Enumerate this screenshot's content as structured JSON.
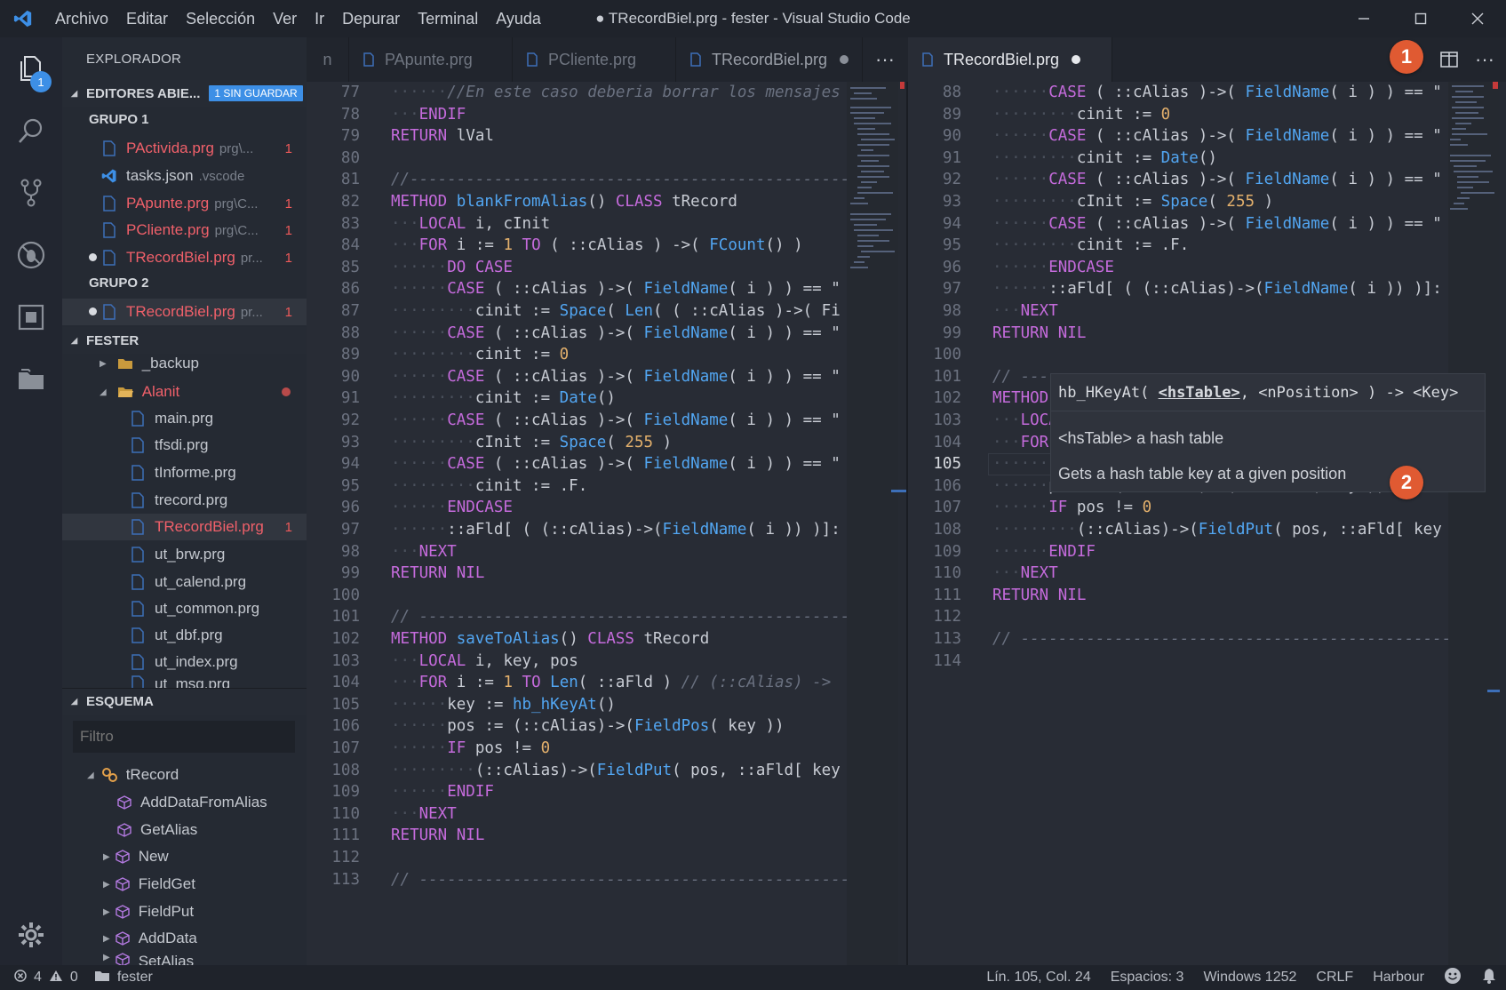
{
  "window": {
    "title": "● TRecordBiel.prg - fester - Visual Studio Code",
    "menu": [
      "Archivo",
      "Editar",
      "Selección",
      "Ver",
      "Ir",
      "Depurar",
      "Terminal",
      "Ayuda"
    ]
  },
  "activity": {
    "explorer_badge": "1"
  },
  "sidebar": {
    "title": "EXPLORADOR",
    "open_editors": {
      "label": "EDITORES ABIE...",
      "badge": "1 SIN GUARDAR",
      "group1": "GRUPO 1",
      "group2": "GRUPO 2",
      "items1": [
        {
          "name": "PActivida.prg",
          "path": "prg\\...",
          "count": "1"
        },
        {
          "name": "tasks.json",
          "path": ".vscode",
          "count": ""
        },
        {
          "name": "PApunte.prg",
          "path": "prg\\C...",
          "count": "1"
        },
        {
          "name": "PCliente.prg",
          "path": "prg\\C...",
          "count": "1"
        },
        {
          "name": "TRecordBiel.prg",
          "path": "pr...",
          "count": "1"
        }
      ],
      "items2": [
        {
          "name": "TRecordBiel.prg",
          "path": "pr...",
          "count": "1"
        }
      ]
    },
    "folder": {
      "label": "FESTER",
      "items": [
        {
          "name": "_backup"
        },
        {
          "name": "Alanit"
        },
        {
          "name": "main.prg"
        },
        {
          "name": "tfsdi.prg"
        },
        {
          "name": "tInforme.prg"
        },
        {
          "name": "trecord.prg"
        },
        {
          "name": "TRecordBiel.prg",
          "count": "1"
        },
        {
          "name": "ut_brw.prg"
        },
        {
          "name": "ut_calend.prg"
        },
        {
          "name": "ut_common.prg"
        },
        {
          "name": "ut_dbf.prg"
        },
        {
          "name": "ut_index.prg"
        },
        {
          "name": "ut_msg.prg"
        }
      ]
    },
    "outline": {
      "label": "ESQUEMA",
      "filter_placeholder": "Filtro",
      "root": "tRecord",
      "items": [
        "AddDataFromAlias",
        "GetAlias",
        "New",
        "FieldGet",
        "FieldPut",
        "AddData",
        "SetAlias"
      ]
    }
  },
  "tabs_left": [
    {
      "label": "n"
    },
    {
      "label": "PApunte.prg"
    },
    {
      "label": "PCliente.prg"
    },
    {
      "label": "TRecordBiel.prg",
      "dirty": true
    }
  ],
  "tabs_right": [
    {
      "label": "TRecordBiel.prg",
      "dirty": true,
      "active": true
    }
  ],
  "more_label": "···",
  "editor_left": {
    "lines": [
      {
        "n": "77",
        "i": 2,
        "t": [
          [
            "cm",
            "//En este caso deberia borrar los mensajes"
          ]
        ]
      },
      {
        "n": "78",
        "i": 1,
        "t": [
          [
            "kw",
            "ENDIF"
          ]
        ]
      },
      {
        "n": "79",
        "i": 0,
        "t": [
          [
            "kw",
            "RETURN"
          ],
          [
            "",
            " lVal"
          ]
        ]
      },
      {
        "n": "80",
        "i": 0,
        "t": []
      },
      {
        "n": "81",
        "i": 0,
        "t": [
          [
            "cm",
            "//-----------------------------------------------"
          ]
        ]
      },
      {
        "n": "82",
        "i": 0,
        "t": [
          [
            "kw",
            "METHOD"
          ],
          [
            "",
            " "
          ],
          [
            "fn",
            "blankFromAlias"
          ],
          [
            "",
            "() "
          ],
          [
            "kw",
            "CLASS"
          ],
          [
            "",
            " tRecord"
          ]
        ]
      },
      {
        "n": "83",
        "i": 1,
        "t": [
          [
            "kw",
            "LOCAL"
          ],
          [
            "",
            " i, cInit"
          ]
        ]
      },
      {
        "n": "84",
        "i": 1,
        "t": [
          [
            "kw",
            "FOR"
          ],
          [
            "",
            " i := "
          ],
          [
            "nm2",
            "1"
          ],
          [
            "",
            " "
          ],
          [
            "kw",
            "TO"
          ],
          [
            "",
            " ( ::cAlias ) ->( "
          ],
          [
            "fn",
            "FCount"
          ],
          [
            "",
            "() )"
          ]
        ]
      },
      {
        "n": "85",
        "i": 2,
        "t": [
          [
            "kw",
            "DO CASE"
          ]
        ]
      },
      {
        "n": "86",
        "i": 2,
        "t": [
          [
            "kw",
            "CASE"
          ],
          [
            "",
            " ( ::cAlias )->( "
          ],
          [
            "fn",
            "FieldName"
          ],
          [
            "",
            "( i ) ) == \""
          ]
        ]
      },
      {
        "n": "87",
        "i": 3,
        "t": [
          [
            "",
            "cinit := "
          ],
          [
            "fn",
            "Space"
          ],
          [
            "",
            "( "
          ],
          [
            "fn",
            "Len"
          ],
          [
            "",
            "( ( ::cAlias )->( Fi"
          ]
        ]
      },
      {
        "n": "88",
        "i": 2,
        "t": [
          [
            "kw",
            "CASE"
          ],
          [
            "",
            " ( ::cAlias )->( "
          ],
          [
            "fn",
            "FieldName"
          ],
          [
            "",
            "( i ) ) == \""
          ]
        ]
      },
      {
        "n": "89",
        "i": 3,
        "t": [
          [
            "",
            "cinit := "
          ],
          [
            "nm2",
            "0"
          ]
        ]
      },
      {
        "n": "90",
        "i": 2,
        "t": [
          [
            "kw",
            "CASE"
          ],
          [
            "",
            " ( ::cAlias )->( "
          ],
          [
            "fn",
            "FieldName"
          ],
          [
            "",
            "( i ) ) == \""
          ]
        ]
      },
      {
        "n": "91",
        "i": 3,
        "t": [
          [
            "",
            "cinit := "
          ],
          [
            "fn",
            "Date"
          ],
          [
            "",
            "()"
          ]
        ]
      },
      {
        "n": "92",
        "i": 2,
        "t": [
          [
            "kw",
            "CASE"
          ],
          [
            "",
            " ( ::cAlias )->( "
          ],
          [
            "fn",
            "FieldName"
          ],
          [
            "",
            "( i ) ) == \""
          ]
        ]
      },
      {
        "n": "93",
        "i": 3,
        "t": [
          [
            "",
            "cInit := "
          ],
          [
            "fn",
            "Space"
          ],
          [
            "",
            "( "
          ],
          [
            "nm2",
            "255"
          ],
          [
            "",
            " )"
          ]
        ]
      },
      {
        "n": "94",
        "i": 2,
        "t": [
          [
            "kw",
            "CASE"
          ],
          [
            "",
            " ( ::cAlias )->( "
          ],
          [
            "fn",
            "FieldName"
          ],
          [
            "",
            "( i ) ) == \""
          ]
        ]
      },
      {
        "n": "95",
        "i": 3,
        "t": [
          [
            "",
            "cinit := .F."
          ]
        ]
      },
      {
        "n": "96",
        "i": 2,
        "t": [
          [
            "kw",
            "ENDCASE"
          ]
        ]
      },
      {
        "n": "97",
        "i": 2,
        "t": [
          [
            "",
            "::aFld[ ( (::cAlias)->("
          ],
          [
            "fn",
            "FieldName"
          ],
          [
            "",
            "( i )) )]:"
          ]
        ]
      },
      {
        "n": "98",
        "i": 1,
        "t": [
          [
            "kw",
            "NEXT"
          ]
        ]
      },
      {
        "n": "99",
        "i": 0,
        "t": [
          [
            "kw",
            "RETURN"
          ],
          [
            "",
            " "
          ],
          [
            "kw",
            "NIL"
          ]
        ]
      },
      {
        "n": "100",
        "i": 0,
        "t": []
      },
      {
        "n": "101",
        "i": 0,
        "t": [
          [
            "cm",
            "// ----------------------------------------------"
          ]
        ]
      },
      {
        "n": "102",
        "i": 0,
        "t": [
          [
            "kw",
            "METHOD"
          ],
          [
            "",
            " "
          ],
          [
            "fn",
            "saveToAlias"
          ],
          [
            "",
            "() "
          ],
          [
            "kw",
            "CLASS"
          ],
          [
            "",
            " tRecord"
          ]
        ]
      },
      {
        "n": "103",
        "i": 1,
        "t": [
          [
            "kw",
            "LOCAL"
          ],
          [
            "",
            " i, key, pos"
          ]
        ]
      },
      {
        "n": "104",
        "i": 1,
        "t": [
          [
            "kw",
            "FOR"
          ],
          [
            "",
            " i := "
          ],
          [
            "nm2",
            "1"
          ],
          [
            "",
            " "
          ],
          [
            "kw",
            "TO"
          ],
          [
            "",
            " "
          ],
          [
            "fn",
            "Len"
          ],
          [
            "",
            "( ::aFld ) "
          ],
          [
            "cm",
            "// (::cAlias) ->"
          ]
        ]
      },
      {
        "n": "105",
        "i": 2,
        "t": [
          [
            "",
            "key := "
          ],
          [
            "fn",
            "hb_hKeyAt"
          ],
          [
            "",
            "()"
          ]
        ]
      },
      {
        "n": "106",
        "i": 2,
        "t": [
          [
            "",
            "pos := (::cAlias)->("
          ],
          [
            "fn",
            "FieldPos"
          ],
          [
            "",
            "( key ))"
          ]
        ]
      },
      {
        "n": "107",
        "i": 2,
        "t": [
          [
            "kw",
            "IF"
          ],
          [
            "",
            " pos != "
          ],
          [
            "nm2",
            "0"
          ]
        ]
      },
      {
        "n": "108",
        "i": 3,
        "t": [
          [
            "",
            "(::cAlias)->("
          ],
          [
            "fn",
            "FieldPut"
          ],
          [
            "",
            "( pos, ::aFld[ key"
          ]
        ]
      },
      {
        "n": "109",
        "i": 2,
        "t": [
          [
            "kw",
            "ENDIF"
          ]
        ]
      },
      {
        "n": "110",
        "i": 1,
        "t": [
          [
            "kw",
            "NEXT"
          ]
        ]
      },
      {
        "n": "111",
        "i": 0,
        "t": [
          [
            "kw",
            "RETURN"
          ],
          [
            "",
            " "
          ],
          [
            "kw",
            "NIL"
          ]
        ]
      },
      {
        "n": "112",
        "i": 0,
        "t": []
      },
      {
        "n": "113",
        "i": 0,
        "t": [
          [
            "cm",
            "// ----------------------------------------------"
          ]
        ]
      }
    ]
  },
  "editor_right": {
    "current_line": "105",
    "lines": [
      {
        "n": "88",
        "i": 2,
        "t": [
          [
            "kw",
            "CASE"
          ],
          [
            "",
            " ( ::cAlias )->( "
          ],
          [
            "fn",
            "FieldName"
          ],
          [
            "",
            "( i ) ) == \""
          ]
        ]
      },
      {
        "n": "89",
        "i": 3,
        "t": [
          [
            "",
            "cinit := "
          ],
          [
            "nm2",
            "0"
          ]
        ]
      },
      {
        "n": "90",
        "i": 2,
        "t": [
          [
            "kw",
            "CASE"
          ],
          [
            "",
            " ( ::cAlias )->( "
          ],
          [
            "fn",
            "FieldName"
          ],
          [
            "",
            "( i ) ) == \""
          ]
        ]
      },
      {
        "n": "91",
        "i": 3,
        "t": [
          [
            "",
            "cinit := "
          ],
          [
            "fn",
            "Date"
          ],
          [
            "",
            "()"
          ]
        ]
      },
      {
        "n": "92",
        "i": 2,
        "t": [
          [
            "kw",
            "CASE"
          ],
          [
            "",
            " ( ::cAlias )->( "
          ],
          [
            "fn",
            "FieldName"
          ],
          [
            "",
            "( i ) ) == \""
          ]
        ]
      },
      {
        "n": "93",
        "i": 3,
        "t": [
          [
            "",
            "cInit := "
          ],
          [
            "fn",
            "Space"
          ],
          [
            "",
            "( "
          ],
          [
            "nm2",
            "255"
          ],
          [
            "",
            " )"
          ]
        ]
      },
      {
        "n": "94",
        "i": 2,
        "t": [
          [
            "kw",
            "CASE"
          ],
          [
            "",
            " ( ::cAlias )->( "
          ],
          [
            "fn",
            "FieldName"
          ],
          [
            "",
            "( i ) ) == \""
          ]
        ]
      },
      {
        "n": "95",
        "i": 3,
        "t": [
          [
            "",
            "cinit := .F."
          ]
        ]
      },
      {
        "n": "96",
        "i": 2,
        "t": [
          [
            "kw",
            "ENDCASE"
          ]
        ]
      },
      {
        "n": "97",
        "i": 2,
        "t": [
          [
            "",
            "::aFld[ ( (::cAlias)->("
          ],
          [
            "fn",
            "FieldName"
          ],
          [
            "",
            "( i )) )]:"
          ]
        ]
      },
      {
        "n": "98",
        "i": 1,
        "t": [
          [
            "kw",
            "NEXT"
          ]
        ]
      },
      {
        "n": "99",
        "i": 0,
        "t": [
          [
            "kw",
            "RETURN"
          ],
          [
            "",
            " "
          ],
          [
            "kw",
            "NIL"
          ]
        ]
      },
      {
        "n": "100",
        "i": 0,
        "t": []
      },
      {
        "n": "101",
        "i": 0,
        "t": [
          [
            "cm",
            "// ---"
          ]
        ]
      },
      {
        "n": "102",
        "i": 0,
        "t": [
          [
            "kw",
            "METHOD"
          ]
        ]
      },
      {
        "n": "103",
        "i": 1,
        "t": [
          [
            "kw",
            "LOCA"
          ]
        ]
      },
      {
        "n": "104",
        "i": 1,
        "t": [
          [
            "kw",
            "FOR"
          ]
        ]
      },
      {
        "n": "105",
        "i": 2,
        "t": [
          [
            "",
            "key := "
          ],
          [
            "fn",
            "hb_hKeyAt"
          ],
          [
            "",
            "()"
          ]
        ]
      },
      {
        "n": "106",
        "i": 2,
        "t": [
          [
            "",
            "pos := (::cAlias)->("
          ],
          [
            "fn",
            "FieldPos"
          ],
          [
            "",
            "( key ))"
          ]
        ]
      },
      {
        "n": "107",
        "i": 2,
        "t": [
          [
            "kw",
            "IF"
          ],
          [
            "",
            " pos != "
          ],
          [
            "nm2",
            "0"
          ]
        ]
      },
      {
        "n": "108",
        "i": 3,
        "t": [
          [
            "",
            "(::cAlias)->("
          ],
          [
            "fn",
            "FieldPut"
          ],
          [
            "",
            "( pos, ::aFld[ key"
          ]
        ]
      },
      {
        "n": "109",
        "i": 2,
        "t": [
          [
            "kw",
            "ENDIF"
          ]
        ]
      },
      {
        "n": "110",
        "i": 1,
        "t": [
          [
            "kw",
            "NEXT"
          ]
        ]
      },
      {
        "n": "111",
        "i": 0,
        "t": [
          [
            "kw",
            "RETURN"
          ],
          [
            "",
            " "
          ],
          [
            "kw",
            "NIL"
          ]
        ]
      },
      {
        "n": "112",
        "i": 0,
        "t": []
      },
      {
        "n": "113",
        "i": 0,
        "t": [
          [
            "cm",
            "// ----------------------------------------------"
          ]
        ]
      },
      {
        "n": "114",
        "i": 0,
        "t": []
      }
    ]
  },
  "hover": {
    "sig_pre": "hb_HKeyAt( ",
    "sig_param": "<hsTable>",
    "sig_post": ", <nPosition> ) -> <Key>",
    "param_doc": "<hsTable> a hash table",
    "desc": "Gets a hash table key at a given position"
  },
  "callouts": [
    "1",
    "2"
  ],
  "status": {
    "errors": "4",
    "warnings": "0",
    "folder": "fester",
    "position": "Lín. 105, Col. 24",
    "spaces": "Espacios: 3",
    "encoding": "Windows 1252",
    "eol": "CRLF",
    "language": "Harbour"
  },
  "colors": {
    "accent": "#3d8fe6",
    "callout": "#e05a32",
    "error_text": "#f0606a"
  }
}
